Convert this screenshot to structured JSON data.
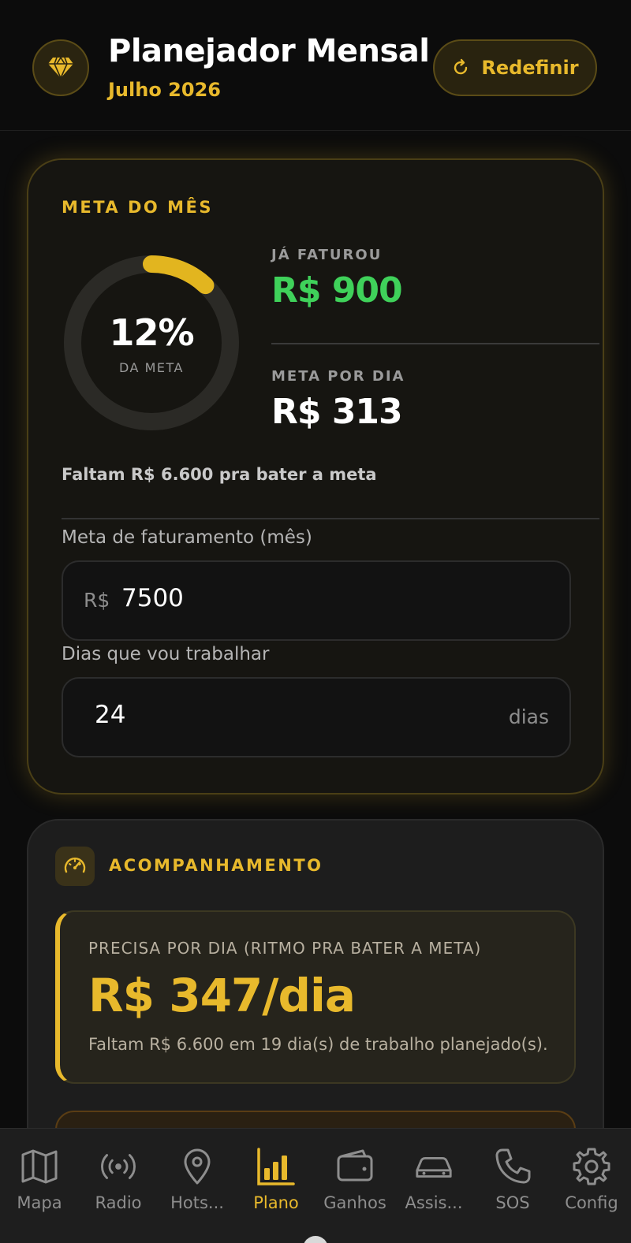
{
  "header": {
    "title": "Planejador Mensal",
    "subtitle": "Julho 2026",
    "reset_label": "Redefinir"
  },
  "goal": {
    "section_label": "META DO MÊS",
    "progress_percent": 12,
    "progress_text": "12%",
    "progress_caption": "DA META",
    "billed_label": "JÁ FATUROU",
    "billed_value": "R$ 900",
    "per_day_label": "META POR DIA",
    "per_day_value": "R$ 313",
    "remaining_text": "Faltam R$ 6.600 pra bater a meta",
    "revenue_label": "Meta de faturamento (mês)",
    "revenue_prefix": "R$",
    "revenue_value": "7500",
    "days_label": "Dias que vou trabalhar",
    "days_value": "24",
    "days_suffix": "dias"
  },
  "tracking": {
    "section_label": "ACOMPANHAMENTO",
    "pace_label": "PRECISA POR DIA (RITMO PRA BATER A META)",
    "pace_value": "R$ 347/dia",
    "pace_sub": "Faltam R$ 6.600 em 19 dia(s) de trabalho planejado(s)."
  },
  "nav": {
    "items": [
      {
        "label": "Mapa",
        "icon": "map-icon"
      },
      {
        "label": "Radio",
        "icon": "radio-icon"
      },
      {
        "label": "Hots...",
        "icon": "location-pin-icon"
      },
      {
        "label": "Plano",
        "icon": "bar-chart-icon"
      },
      {
        "label": "Ganhos",
        "icon": "wallet-icon"
      },
      {
        "label": "Assis...",
        "icon": "car-icon"
      },
      {
        "label": "SOS",
        "icon": "phone-icon"
      },
      {
        "label": "Config",
        "icon": "gear-icon"
      }
    ],
    "active": "Plano"
  },
  "colors": {
    "accent": "#e8b92c",
    "success": "#3fd15a",
    "background": "#0c0c0c"
  }
}
